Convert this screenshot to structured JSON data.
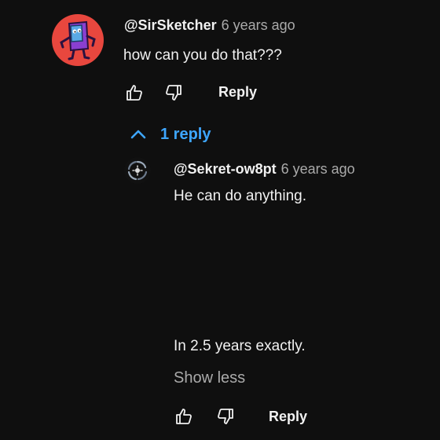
{
  "comment": {
    "author": "@SirSketcher",
    "time": "6 years ago",
    "text": "how can you do that???",
    "actions": {
      "like_icon": "thumbs-up-icon",
      "dislike_icon": "thumbs-down-icon",
      "reply_label": "Reply"
    }
  },
  "replies_toggle": {
    "label": "1 reply",
    "icon": "chevron-up-icon",
    "color": "#3ea6ff"
  },
  "reply": {
    "author": "@Sekret-ow8pt",
    "time": "6 years ago",
    "text_line1": "He can do anything.",
    "text_line2": "In 2.5 years exactly.",
    "show_less_label": "Show less",
    "actions": {
      "like_icon": "thumbs-up-icon",
      "dislike_icon": "thumbs-down-icon",
      "reply_label": "Reply"
    }
  },
  "colors": {
    "background": "#0f0f0f",
    "text": "#f1f1f1",
    "secondary_text": "#aaaaaa",
    "avatar_bg": "#e8473e"
  }
}
